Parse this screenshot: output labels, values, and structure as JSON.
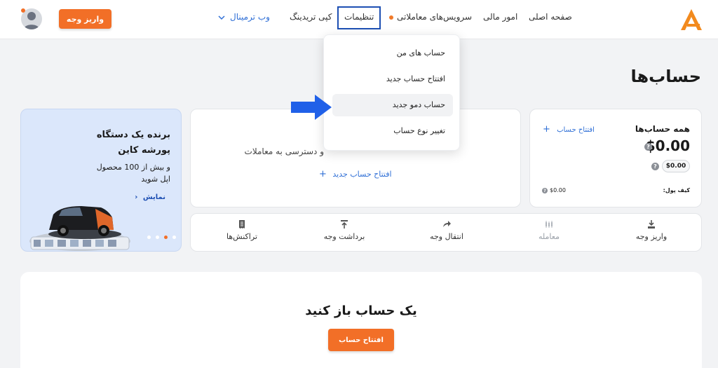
{
  "colors": {
    "accent": "#f26f27",
    "link": "#2f6fd6",
    "highlight_border": "#1d4fb3",
    "arrow": "#2060e8"
  },
  "logo": {
    "icon": "a-logo-icon"
  },
  "nav": {
    "home": "صفحه اصلی",
    "finance": "امور مالی",
    "trading_services": "سرویس‌های معاملاتی",
    "settings": "تنظیمات",
    "copy_trading": "کپی تریدینگ",
    "web_terminal": "وب ترمینال"
  },
  "header": {
    "deposit_label": "واریز وجه",
    "avatar_icon": "user-avatar-icon"
  },
  "dropdown": {
    "items": [
      "حساب های من",
      "افتتاح حساب جدید",
      "حساب دمو جدید",
      "تغییر نوع حساب"
    ]
  },
  "page": {
    "title": "حساب‌ها"
  },
  "accounts_card": {
    "title": "همه حساب‌ها",
    "open_label": "افتتاح حساب",
    "balance": "$0.00",
    "pill": "$0.00",
    "wallet_label": "کیف پول:",
    "wallet_value": "$0.00"
  },
  "mid_card": {
    "line1": "و دسترسی به معاملات",
    "link": "افتتاح حساب جدید"
  },
  "promo": {
    "title_line1": "برنده یک دستگاه",
    "title_line2": "پورشه کاین",
    "subtitle": "و بیش از 100 محصول اپل شوید",
    "link": "نمایش"
  },
  "actions": [
    {
      "label": "واریز وجه",
      "icon": "download-icon"
    },
    {
      "label": "معامله",
      "icon": "candles-icon"
    },
    {
      "label": "انتقال وجه",
      "icon": "transfer-icon"
    },
    {
      "label": "برداشت وجه",
      "icon": "upload-icon"
    },
    {
      "label": "تراکنش‌ها",
      "icon": "receipt-icon"
    }
  ],
  "bottom": {
    "title": "یک حساب باز کنید",
    "button": "افتتاح حساب"
  }
}
